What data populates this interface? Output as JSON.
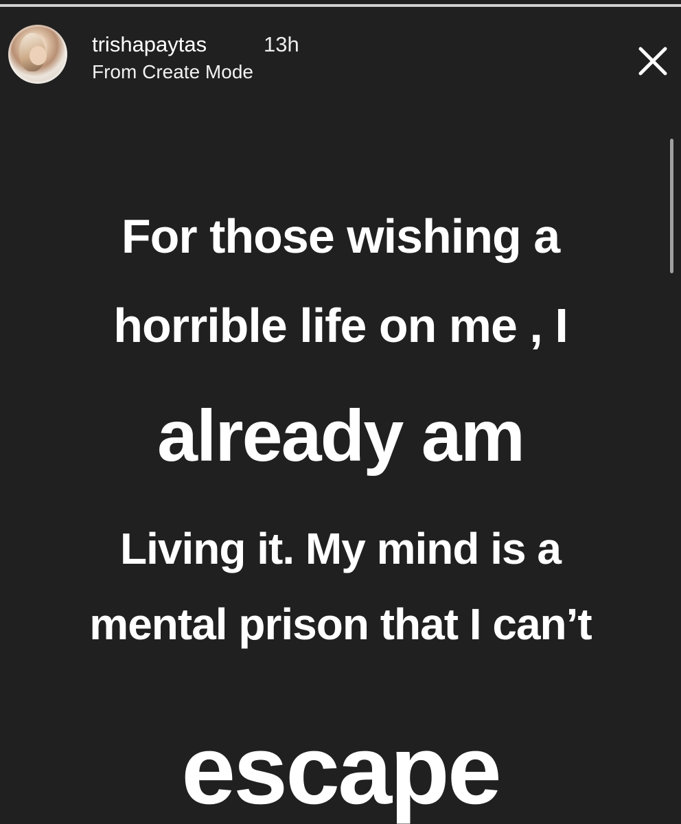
{
  "colors": {
    "background": "#202020",
    "text": "#ffffff",
    "progress_track": "#8a8a8a",
    "progress_fill": "#cfcfcf"
  },
  "story": {
    "progress": 1.0,
    "header": {
      "avatar_icon": "profile-avatar-icon",
      "username": "trishapaytas",
      "time": "13h",
      "source": "From Create Mode",
      "close_icon": "close-icon"
    },
    "content": {
      "lines": [
        "For those wishing a",
        "horrible life on me , I",
        "already am",
        "Living it. My mind is a",
        "mental prison that I can’t",
        "escape"
      ]
    }
  }
}
